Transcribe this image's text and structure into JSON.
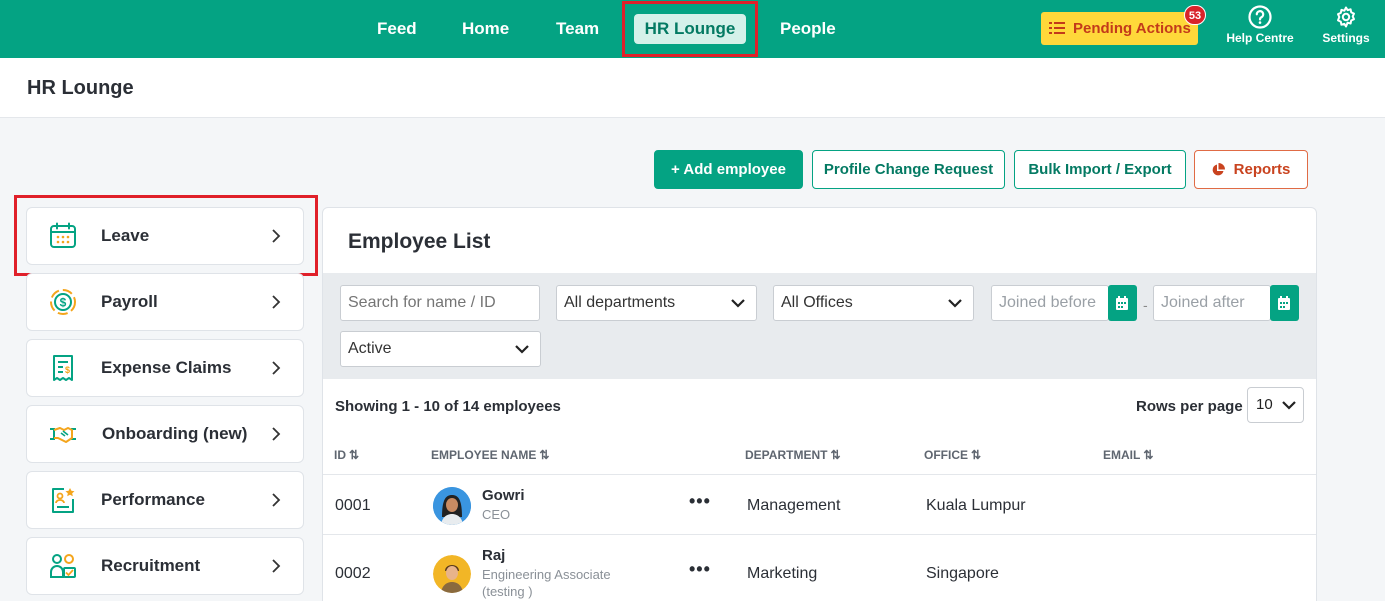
{
  "nav": {
    "items": [
      "Feed",
      "Home",
      "Team",
      "HR Lounge",
      "People"
    ],
    "pending_label": "Pending Actions",
    "pending_count": "53",
    "help_label": "Help Centre",
    "settings_label": "Settings"
  },
  "header": {
    "title": "HR Lounge"
  },
  "actions": {
    "add_employee": "+ Add employee",
    "profile_change": "Profile Change Request",
    "bulk_import": "Bulk Import / Export",
    "reports": "Reports"
  },
  "sidebar": {
    "items": [
      {
        "label": "Leave",
        "icon": "calendar-icon"
      },
      {
        "label": "Payroll",
        "icon": "payroll-dollar-icon"
      },
      {
        "label": "Expense Claims",
        "icon": "receipt-icon"
      },
      {
        "label": "Onboarding (new)",
        "icon": "handshake-icon"
      },
      {
        "label": "Performance",
        "icon": "performance-badge-icon"
      },
      {
        "label": "Recruitment",
        "icon": "recruitment-people-icon"
      }
    ]
  },
  "panel": {
    "title": "Employee List",
    "filters": {
      "search_placeholder": "Search for name / ID",
      "department": "All departments",
      "office": "All Offices",
      "joined_before": "Joined before",
      "joined_after": "Joined after",
      "status": "Active"
    },
    "showing": "Showing 1 - 10 of 14 employees",
    "rows_per_page_label": "Rows per page",
    "rows_per_page": "10",
    "columns": [
      "ID",
      "EMPLOYEE NAME",
      "DEPARTMENT",
      "OFFICE",
      "EMAIL"
    ],
    "rows": [
      {
        "id": "0001",
        "name": "Gowri",
        "title": "CEO",
        "department": "Management",
        "office": "Kuala Lumpur",
        "email": ""
      },
      {
        "id": "0002",
        "name": "Raj",
        "title": "Engineering Associate (testing )",
        "department": "Marketing",
        "office": "Singapore",
        "email": ""
      }
    ],
    "row_menu": "•••"
  },
  "colors": {
    "brand": "#04a383",
    "highlight": "#e0202a",
    "pending": "#ffd83a"
  }
}
